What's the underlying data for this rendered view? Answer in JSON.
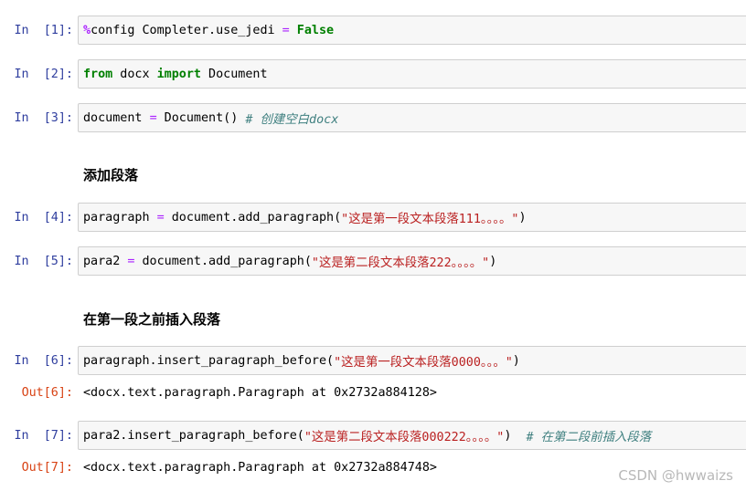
{
  "cells": [
    {
      "in_prompt": "In  [1]:",
      "tokens": {
        "pct": "%",
        "rest": "config Completer.use_jedi ",
        "eq": "=",
        "val": " False"
      }
    },
    {
      "in_prompt": "In  [2]:",
      "tokens": {
        "kw1": "from",
        "mid": " docx ",
        "kw2": "import",
        "end": " Document"
      }
    },
    {
      "in_prompt": "In  [3]:",
      "tokens": {
        "lhs": "document ",
        "eq": "=",
        "rhs": " Document() ",
        "comment": "# 创建空白docx"
      }
    },
    {
      "in_prompt": "In  [4]:",
      "tokens": {
        "lhs": "paragraph ",
        "eq": "=",
        "rhs": " document.add_paragraph(",
        "str": "\"这是第一段文本段落111。。。。\"",
        "close": ")"
      }
    },
    {
      "in_prompt": "In  [5]:",
      "tokens": {
        "lhs": "para2 ",
        "eq": "=",
        "rhs": " document.add_paragraph(",
        "str": "\"这是第二段文本段落222。。。。\"",
        "close": ")"
      }
    },
    {
      "in_prompt": "In  [6]:",
      "out_prompt": "Out[6]:",
      "output": "<docx.text.paragraph.Paragraph at 0x2732a884128>",
      "tokens": {
        "call": "paragraph.insert_paragraph_before(",
        "str": "\"这是第一段文本段落0000。。。\"",
        "close": ")"
      }
    },
    {
      "in_prompt": "In  [7]:",
      "out_prompt": "Out[7]:",
      "output": "<docx.text.paragraph.Paragraph at 0x2732a884748>",
      "tokens": {
        "call": "para2.insert_paragraph_before(",
        "str": "\"这是第二段文本段落000222。。。。\"",
        "close": ")  ",
        "comment": "# 在第二段前插入段落"
      }
    }
  ],
  "headings": {
    "add_paragraph": "添加段落",
    "insert_before": "在第一段之前插入段落"
  },
  "watermark": "CSDN @hwwaizs",
  "colors": {
    "keyword": "#008000",
    "operator": "#aa22ff",
    "string": "#ba2121",
    "comment": "#408080",
    "in_prompt": "#303f9f",
    "out_prompt": "#d84315",
    "cell_bg": "#f7f7f7",
    "cell_border": "#cfcfcf"
  }
}
